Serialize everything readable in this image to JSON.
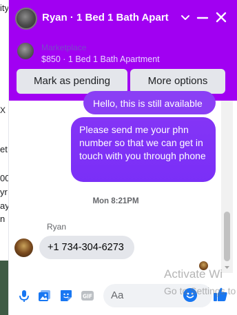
{
  "background_page": {
    "fragments": [
      "ity",
      "X",
      "et",
      "00",
      "yr",
      "ay",
      "n"
    ]
  },
  "header": {
    "title": "Ryan · 1 Bed 1 Bath Apart",
    "marketplace_label": "Marketplace",
    "listing": "$850 · 1 Bed 1 Bath Apartment",
    "buttons": {
      "mark_pending": "Mark as pending",
      "more_options": "More options"
    }
  },
  "messages": {
    "outgoing_partial": "Hello, this is still available",
    "outgoing": "Please send me your phn number so that we can get in touch with you through phone",
    "timestamp": "Mon 8:21PM",
    "sender_name": "Ryan",
    "incoming": "+1 734-304-6273"
  },
  "composer": {
    "placeholder": "Aa"
  },
  "watermark": {
    "line1": "Activate Wi",
    "line2": "Go to Settings to"
  },
  "colors": {
    "header_bg": "#a100f2",
    "outgoing_bubble": "#7a2ff7",
    "incoming_bubble": "#e4e6eb",
    "icon_accent": "#1877f2"
  }
}
